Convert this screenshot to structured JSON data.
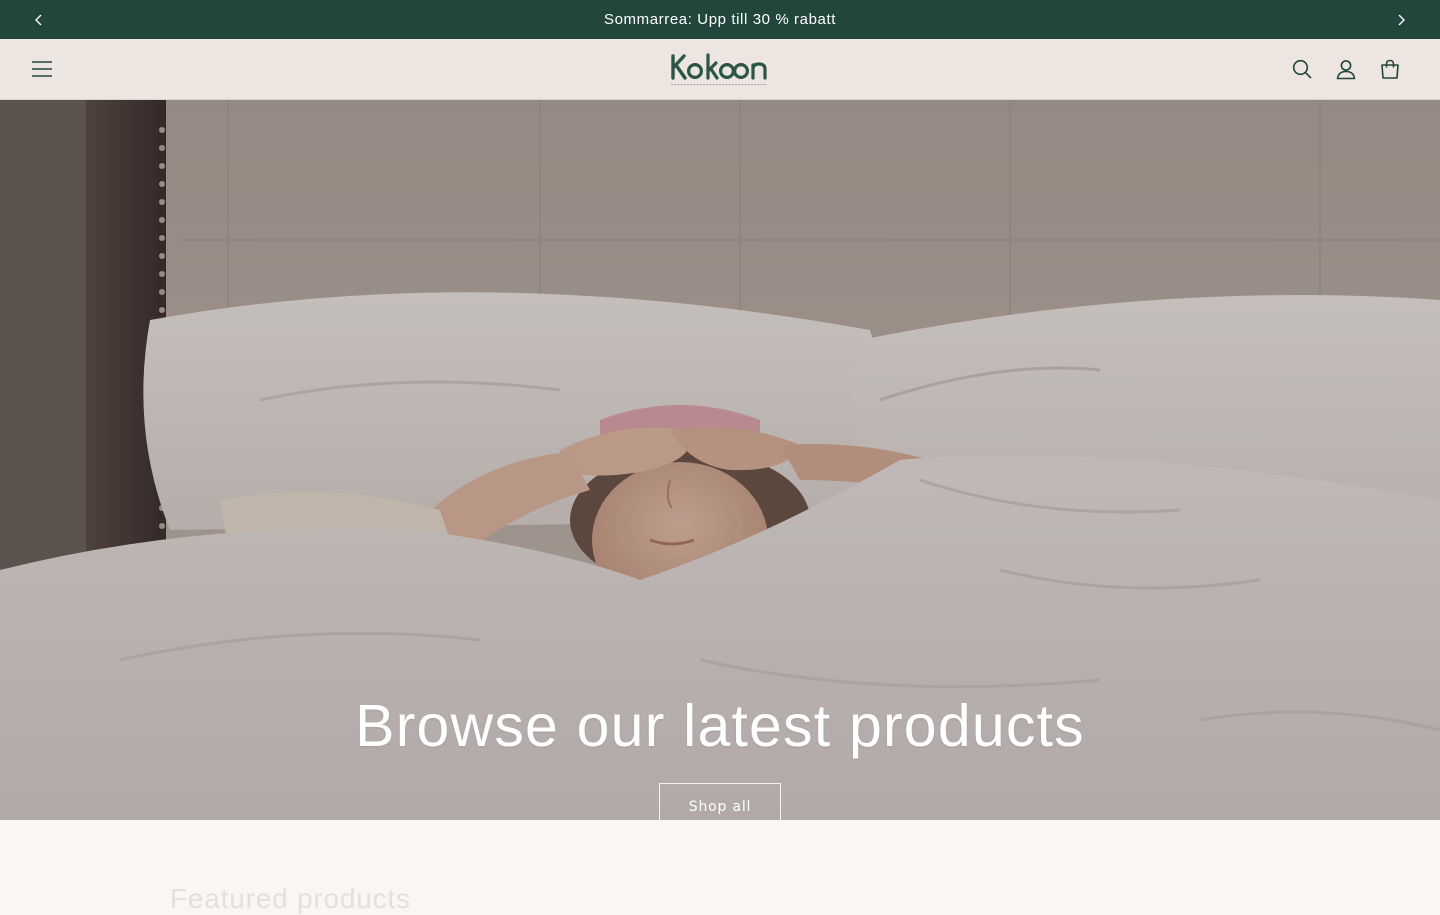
{
  "announcement": {
    "text": "Sommarrea: Upp till 30 % rabatt",
    "prev_icon": "chevron-left-icon",
    "next_icon": "chevron-right-icon"
  },
  "header": {
    "menu_icon": "hamburger-menu-icon",
    "logo": {
      "name": "Kokoon",
      "tagline": "SWITCH OFF. LOOSEN. COME HOME TO YOU."
    },
    "search_icon": "search-icon",
    "account_icon": "account-icon",
    "cart_icon": "cart-icon"
  },
  "hero": {
    "title": "Browse our latest products",
    "button_label": "Shop all"
  },
  "featured": {
    "title": "Featured products"
  },
  "colors": {
    "announcement_bg": "#22463c",
    "header_bg": "#ede5e0",
    "page_bg": "#faf6f3",
    "brand_green": "#2b5546"
  }
}
